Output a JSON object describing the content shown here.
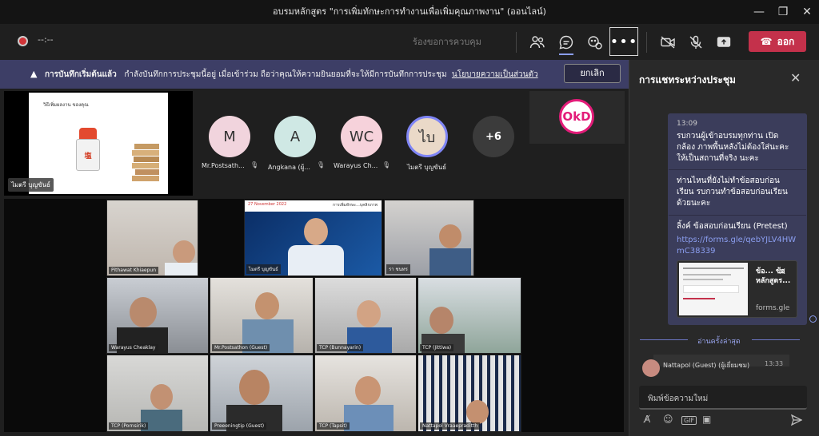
{
  "window": {
    "title": "อบรมหลักสูตร \"การเพิ่มทักษะการทำงานเพื่อเพิ่มคุณภาพงาน\" (ออนไลน์)"
  },
  "toolbar": {
    "timer": "--:--",
    "request_control": "ร้องขอการควบคุม",
    "more_label": "•••",
    "leave_label": "ออก"
  },
  "banner": {
    "title": "การบันทึกเริ่มต้นแล้ว",
    "message": "กำลังบันทึกการประชุมนี้อยู่ เมื่อเข้าร่วม ถือว่าคุณให้ความยินยอมที่จะให้มีการบันทึกการประชุม",
    "policy_link": "นโยบายความเป็นส่วนตัว",
    "cancel_label": "ยกเลิก"
  },
  "shared_content": {
    "presenter": "ไมตรี บุญขันธ์",
    "slide_caption": "วิธีเพิ่มผลงาน ของคุณ"
  },
  "participants": [
    {
      "initials": "M",
      "name": "Mr.Postsath...",
      "color": "#f1d4dd"
    },
    {
      "initials": "A",
      "name": "Angkana (ผู้...",
      "color": "#cfe8e4"
    },
    {
      "initials": "WC",
      "name": "Warayus Ch...",
      "color": "#f6d2db"
    },
    {
      "initials": "ไบ",
      "name": "ไมตรี บุญขันธ์",
      "color": "#ead9c8"
    }
  ],
  "overflow_count": "+6",
  "brand_logo_text": "OkD",
  "gallery_labels": [
    "Pithawat Khiaepun",
    "ไมตรี บุญขันธ์",
    "รา ชนทร",
    "Warayus Cheaklay",
    "Mr.Postsathon (Guest)",
    "TCP (Bunnayarin)",
    "TCP (Jittiwa)",
    "TCP (Pornsirik)",
    "Preeeningtip (Guest)",
    "TCP (Tapsit)",
    "Nattapol Vraaepraditth"
  ],
  "slide_title_strip": "การเพิ่มทักษะ...บุคลิกภาพ",
  "slide_date": "27 November 2022",
  "chat": {
    "title": "การแชทระหว่างประชุม",
    "time": "13:09",
    "msg1": "รบกวนผู้เข้าอบรมทุกท่าน เปิดกล้อง ภาพพื้นหลังไม่ต้องใส่นะคะ ให้เป็นสถานที่จริง นะคะ",
    "msg2": "ท่านไหนที่ยังไม่ทำข้อสอบก่อนเรียน รบกวนทำข้อสอบก่อนเรียนด้วยนะคะ",
    "msg3": "ลิ้งค์ ข้อสอบก่อนเรียน (Pretest)",
    "link": "https://forms.gle/qebYJLV4HWmC38339",
    "preview_title": "ข้อ... ข้อ หลักสูตร...",
    "preview_domain": "forms.gle",
    "last_read": "อ่านครั้งล่าสุด",
    "next_sender": "Nattapol (Guest) (ผู้เยี่ยมชม)",
    "next_time": "13:33",
    "compose_placeholder": "พิมพ์ข้อความใหม่"
  },
  "colors": {
    "leave": "#c4314b",
    "banner": "#3d3e66",
    "chat_card": "#3b3d5b",
    "accent": "#8b9ef0"
  }
}
